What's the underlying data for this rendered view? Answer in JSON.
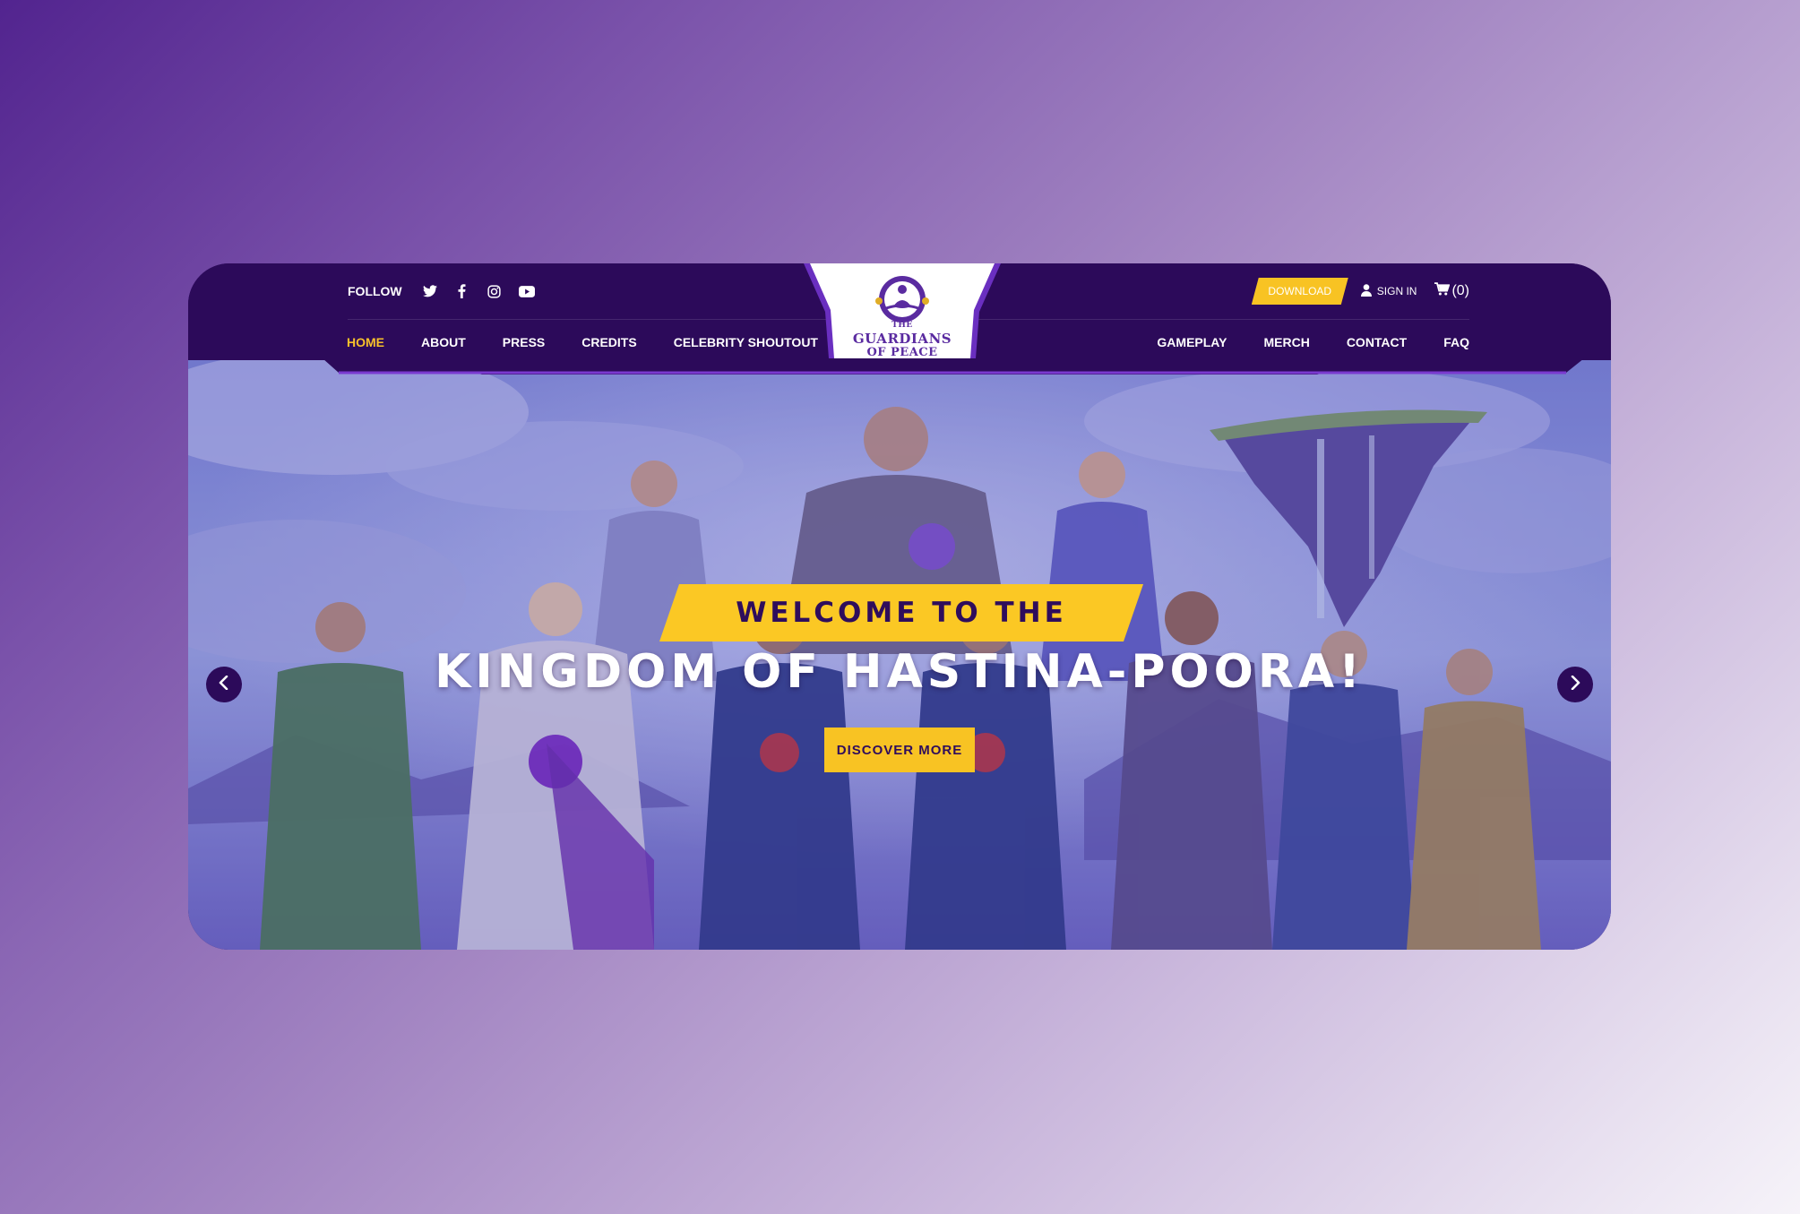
{
  "header": {
    "follow_label": "FOLLOW",
    "social": [
      "twitter-icon",
      "facebook-icon",
      "instagram-icon",
      "youtube-icon"
    ],
    "download_label": "DOWNLOAD",
    "signin_label": "SIGN IN",
    "cart_count": "(0)",
    "logo": {
      "line1": "THE",
      "line2": "GUARDIANS",
      "line3": "OF PEACE"
    },
    "nav_left": [
      "HOME",
      "ABOUT",
      "PRESS",
      "CREDITS",
      "CELEBRITY SHOUTOUT"
    ],
    "nav_right": [
      "GAMEPLAY",
      "MERCH",
      "CONTACT",
      "FAQ"
    ],
    "active_nav": "HOME"
  },
  "hero": {
    "banner_text": "WELCOME TO THE",
    "title": "KINGDOM OF HASTINA-POORA!",
    "button_label": "DISCOVER MORE"
  },
  "colors": {
    "header_bg": "#2c0a5a",
    "accent_yellow": "#f8c323",
    "accent_purple": "#6a2fc0"
  }
}
